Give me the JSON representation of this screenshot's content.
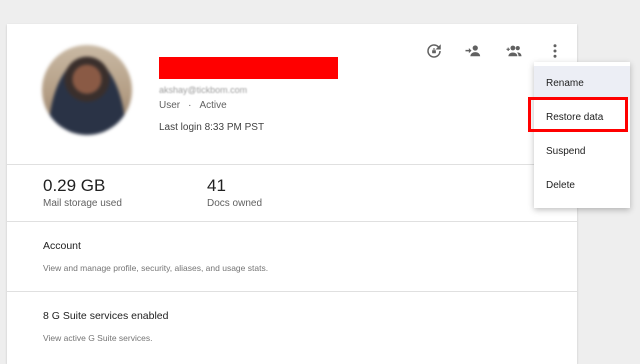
{
  "user": {
    "email": "akshay@tickbom.com",
    "role": "User",
    "separator": "·",
    "status": "Active",
    "last_login": "Last login 8:33 PM PST"
  },
  "toolbar": {
    "icons": [
      "restore-icon",
      "transfer-icon",
      "add-group-icon",
      "more-vert-icon"
    ]
  },
  "stats": [
    {
      "value": "0.29 GB",
      "label": "Mail storage used"
    },
    {
      "value": "41",
      "label": "Docs owned"
    }
  ],
  "sections": [
    {
      "title": "Account",
      "subtitle": "View and manage profile, security, aliases, and usage stats."
    },
    {
      "title": "8 G Suite services enabled",
      "subtitle": "View active G Suite services."
    }
  ],
  "menu": {
    "items": [
      "Rename",
      "Restore data",
      "Suspend",
      "Delete"
    ],
    "hovered_index": 0,
    "highlighted_index": 1
  },
  "colors": {
    "redaction": "#ff0000",
    "highlight_border": "#ff0000",
    "menu_hover": "#eceef5"
  }
}
